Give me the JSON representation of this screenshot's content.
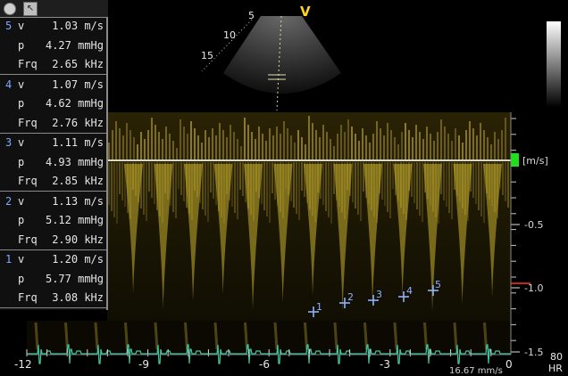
{
  "panel": {
    "measurements": [
      {
        "index": "5",
        "v_label": "v",
        "v": "1.03 m/s",
        "p_label": "p",
        "p": "4.27 mmHg",
        "f_label": "Frq",
        "f": "2.65 kHz"
      },
      {
        "index": "4",
        "v_label": "v",
        "v": "1.07 m/s",
        "p_label": "p",
        "p": "4.62 mmHg",
        "f_label": "Frq",
        "f": "2.76 kHz"
      },
      {
        "index": "3",
        "v_label": "v",
        "v": "1.11 m/s",
        "p_label": "p",
        "p": "4.93 mmHg",
        "f_label": "Frq",
        "f": "2.85 kHz"
      },
      {
        "index": "2",
        "v_label": "v",
        "v": "1.13 m/s",
        "p_label": "p",
        "p": "5.12 mmHg",
        "f_label": "Frq",
        "f": "2.90 kHz"
      },
      {
        "index": "1",
        "v_label": "v",
        "v": "1.20 m/s",
        "p_label": "p",
        "p": "5.77 mmHg",
        "f_label": "Frq",
        "f": "3.08 kHz"
      }
    ]
  },
  "sector": {
    "depth_labels": [
      "5",
      "10",
      "15"
    ],
    "marker": "V"
  },
  "spectrum": {
    "unit_label": "[m/s]",
    "velocity_ticks": [
      "-0.5",
      "-1.0",
      "-1.5"
    ],
    "time_ticks": [
      "-12",
      "-9",
      "-6",
      "-3",
      "0"
    ],
    "sweep_speed": "16.67 mm/s",
    "heart_rate_value": "80",
    "heart_rate_label": "HR",
    "markers": [
      "1",
      "2",
      "3",
      "4",
      "5"
    ]
  },
  "colors": {
    "doppler": "#c8b030",
    "ecg": "#3fc7a0",
    "marker": "#8fb0ff",
    "baseline_indicator": "#22dd22",
    "scale_marker": "#ff3322"
  }
}
